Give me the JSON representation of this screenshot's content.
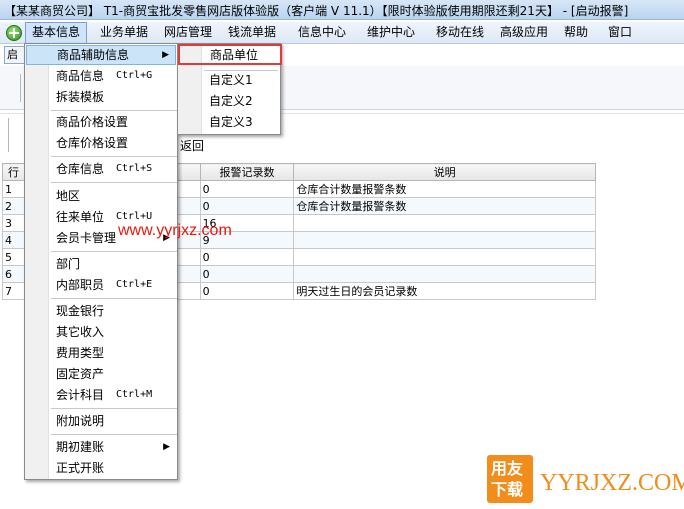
{
  "title_bar": {
    "text": "【某某商贸公司】 T1-商贸宝批发零售网店版体验版（客户端 V 11.1）【限时体验版使用期限还剩21天】 - [启动报警]"
  },
  "menubar": {
    "items": [
      {
        "label": "基本信息"
      },
      {
        "label": "业务单据"
      },
      {
        "label": "网店管理"
      },
      {
        "label": "钱流单据"
      },
      {
        "label": "信息中心"
      },
      {
        "label": "维护中心"
      },
      {
        "label": "移动在线"
      },
      {
        "label": "高级应用"
      },
      {
        "label": "帮助"
      },
      {
        "label": "窗口"
      }
    ]
  },
  "background": {
    "tab_label": "启",
    "return_label": "返回"
  },
  "table": {
    "headers": {
      "row": "行",
      "count": "报警记录数",
      "desc": "说明"
    },
    "rows": [
      {
        "n": "1",
        "count": "0",
        "desc": "仓库合计数量报警条数"
      },
      {
        "n": "2",
        "count": "0",
        "desc": "仓库合计数量报警条数"
      },
      {
        "n": "3",
        "count": "16",
        "desc": ""
      },
      {
        "n": "4",
        "count": "9",
        "desc": ""
      },
      {
        "n": "5",
        "count": "0",
        "desc": ""
      },
      {
        "n": "6",
        "count": "0",
        "desc": ""
      },
      {
        "n": "7",
        "count": "0",
        "desc": "明天过生日的会员记录数"
      }
    ]
  },
  "dropdown": {
    "items": [
      {
        "label": "商品辅助信息",
        "submenu": true
      },
      {
        "label": "商品信息",
        "shortcut": "Ctrl+G"
      },
      {
        "label": "拆装模板"
      },
      {
        "label": "商品价格设置"
      },
      {
        "label": "仓库价格设置"
      },
      {
        "label": "仓库信息",
        "shortcut": "Ctrl+S"
      },
      {
        "label": "地区"
      },
      {
        "label": "往来单位",
        "shortcut": "Ctrl+U"
      },
      {
        "label": "会员卡管理",
        "submenu": true
      },
      {
        "label": "部门"
      },
      {
        "label": "内部职员",
        "shortcut": "Ctrl+E"
      },
      {
        "label": "现金银行"
      },
      {
        "label": "其它收入"
      },
      {
        "label": "费用类型"
      },
      {
        "label": "固定资产"
      },
      {
        "label": "会计科目",
        "shortcut": "Ctrl+M"
      },
      {
        "label": "附加说明"
      },
      {
        "label": "期初建账",
        "submenu": true
      },
      {
        "label": "正式开账"
      }
    ]
  },
  "submenu": {
    "items": [
      {
        "label": "商品单位"
      },
      {
        "label": "自定义1"
      },
      {
        "label": "自定义2"
      },
      {
        "label": "自定义3"
      }
    ]
  },
  "watermark": {
    "url_text": "www.yyrjxz.com",
    "logo_line1": "用友",
    "logo_line2": "下载",
    "logo_text": "YYRJXZ.COM"
  },
  "colors": {
    "highlight_box": "#e23a3a",
    "watermark_red": "#e8180c",
    "logo_orange": "#f28c1b",
    "menu_highlight": "#cce4f7"
  }
}
